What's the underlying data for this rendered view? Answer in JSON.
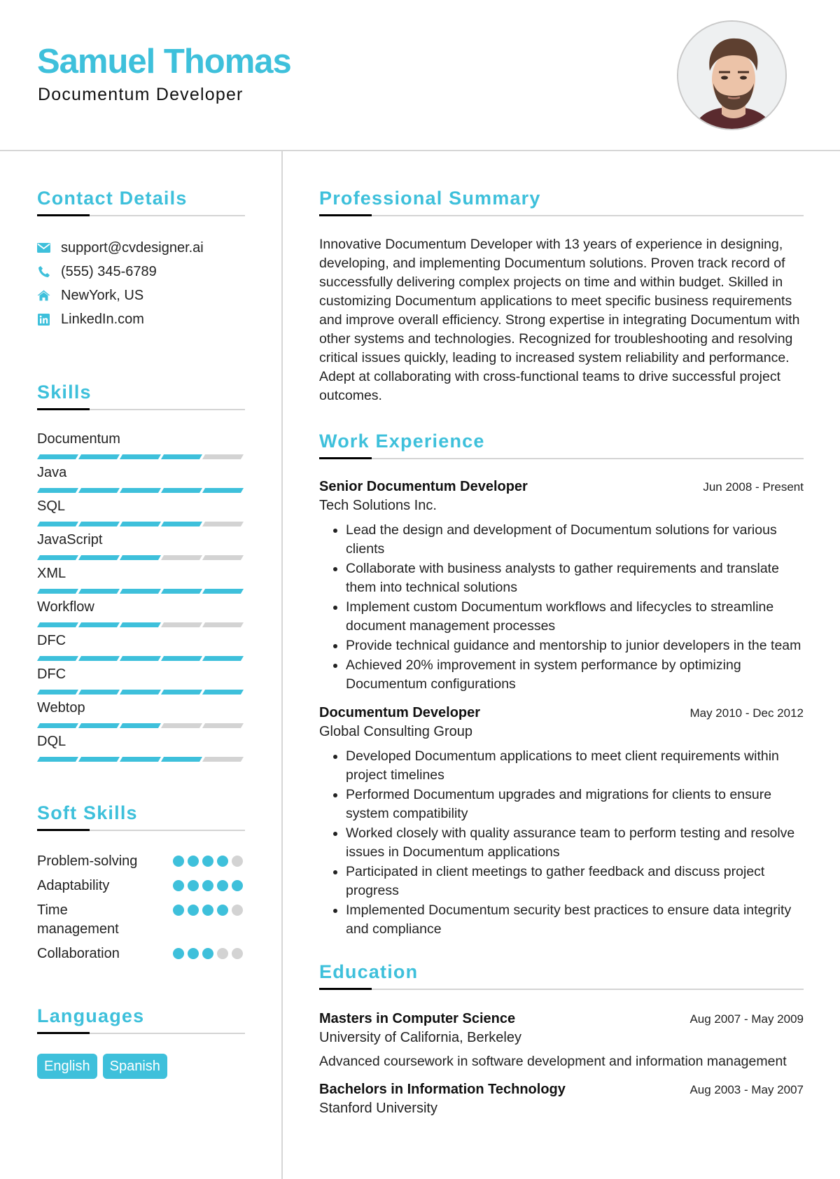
{
  "header": {
    "name": "Samuel Thomas",
    "title": "Documentum Developer",
    "photo_alt": "profile-photo"
  },
  "colors": {
    "accent": "#3ec0db",
    "inactive": "#d3d3d3",
    "rule": "#d4d4d4"
  },
  "contact": {
    "title": "Contact Details",
    "items": [
      {
        "icon": "email-icon",
        "text": "support@cvdesigner.ai"
      },
      {
        "icon": "phone-icon",
        "text": "(555) 345-6789"
      },
      {
        "icon": "home-icon",
        "text": "NewYork, US"
      },
      {
        "icon": "linkedin-icon",
        "text": "LinkedIn.com"
      }
    ]
  },
  "skills": {
    "title": "Skills",
    "max": 5,
    "items": [
      {
        "name": "Documentum",
        "level": 4
      },
      {
        "name": "Java",
        "level": 5
      },
      {
        "name": "SQL",
        "level": 4
      },
      {
        "name": "JavaScript",
        "level": 3
      },
      {
        "name": "XML",
        "level": 5
      },
      {
        "name": "Workflow",
        "level": 3
      },
      {
        "name": "DFC",
        "level": 5
      },
      {
        "name": "DFC",
        "level": 5
      },
      {
        "name": "Webtop",
        "level": 3
      },
      {
        "name": "DQL",
        "level": 4
      }
    ]
  },
  "soft_skills": {
    "title": "Soft Skills",
    "max": 5,
    "items": [
      {
        "name": "Problem-solving",
        "level": 4
      },
      {
        "name": "Adaptability",
        "level": 5
      },
      {
        "name": "Time management",
        "level": 4
      },
      {
        "name": "Collaboration",
        "level": 3
      }
    ]
  },
  "languages": {
    "title": "Languages",
    "items": [
      "English",
      "Spanish"
    ]
  },
  "summary": {
    "title": "Professional Summary",
    "text": "Innovative Documentum Developer with 13 years of experience in designing, developing, and implementing Documentum solutions. Proven track record of successfully delivering complex projects on time and within budget. Skilled in customizing Documentum applications to meet specific business requirements and improve overall efficiency. Strong expertise in integrating Documentum with other systems and technologies. Recognized for troubleshooting and resolving critical issues quickly, leading to increased system reliability and performance. Adept at collaborating with cross-functional teams to drive successful project outcomes."
  },
  "experience": {
    "title": "Work Experience",
    "jobs": [
      {
        "role": "Senior Documentum Developer",
        "company": "Tech Solutions Inc.",
        "dates": "Jun 2008 - Present",
        "bullets": [
          "Lead the design and development of Documentum solutions for various clients",
          "Collaborate with business analysts to gather requirements and translate them into technical solutions",
          "Implement custom Documentum workflows and lifecycles to streamline document management processes",
          "Provide technical guidance and mentorship to junior developers in the team",
          "Achieved 20% improvement in system performance by optimizing Documentum configurations"
        ]
      },
      {
        "role": "Documentum Developer",
        "company": "Global Consulting Group",
        "dates": "May 2010 - Dec 2012",
        "bullets": [
          "Developed Documentum applications to meet client requirements within project timelines",
          "Performed Documentum upgrades and migrations for clients to ensure system compatibility",
          "Worked closely with quality assurance team to perform testing and resolve issues in Documentum applications",
          "Participated in client meetings to gather feedback and discuss project progress",
          "Implemented Documentum security best practices to ensure data integrity and compliance"
        ]
      }
    ]
  },
  "education": {
    "title": "Education",
    "items": [
      {
        "degree": "Masters in Computer Science",
        "school": "University of California, Berkeley",
        "dates": "Aug 2007 - May 2009",
        "description": "Advanced coursework in software development and information management"
      },
      {
        "degree": "Bachelors in Information Technology",
        "school": "Stanford University",
        "dates": "Aug 2003 - May 2007",
        "description": ""
      }
    ]
  }
}
